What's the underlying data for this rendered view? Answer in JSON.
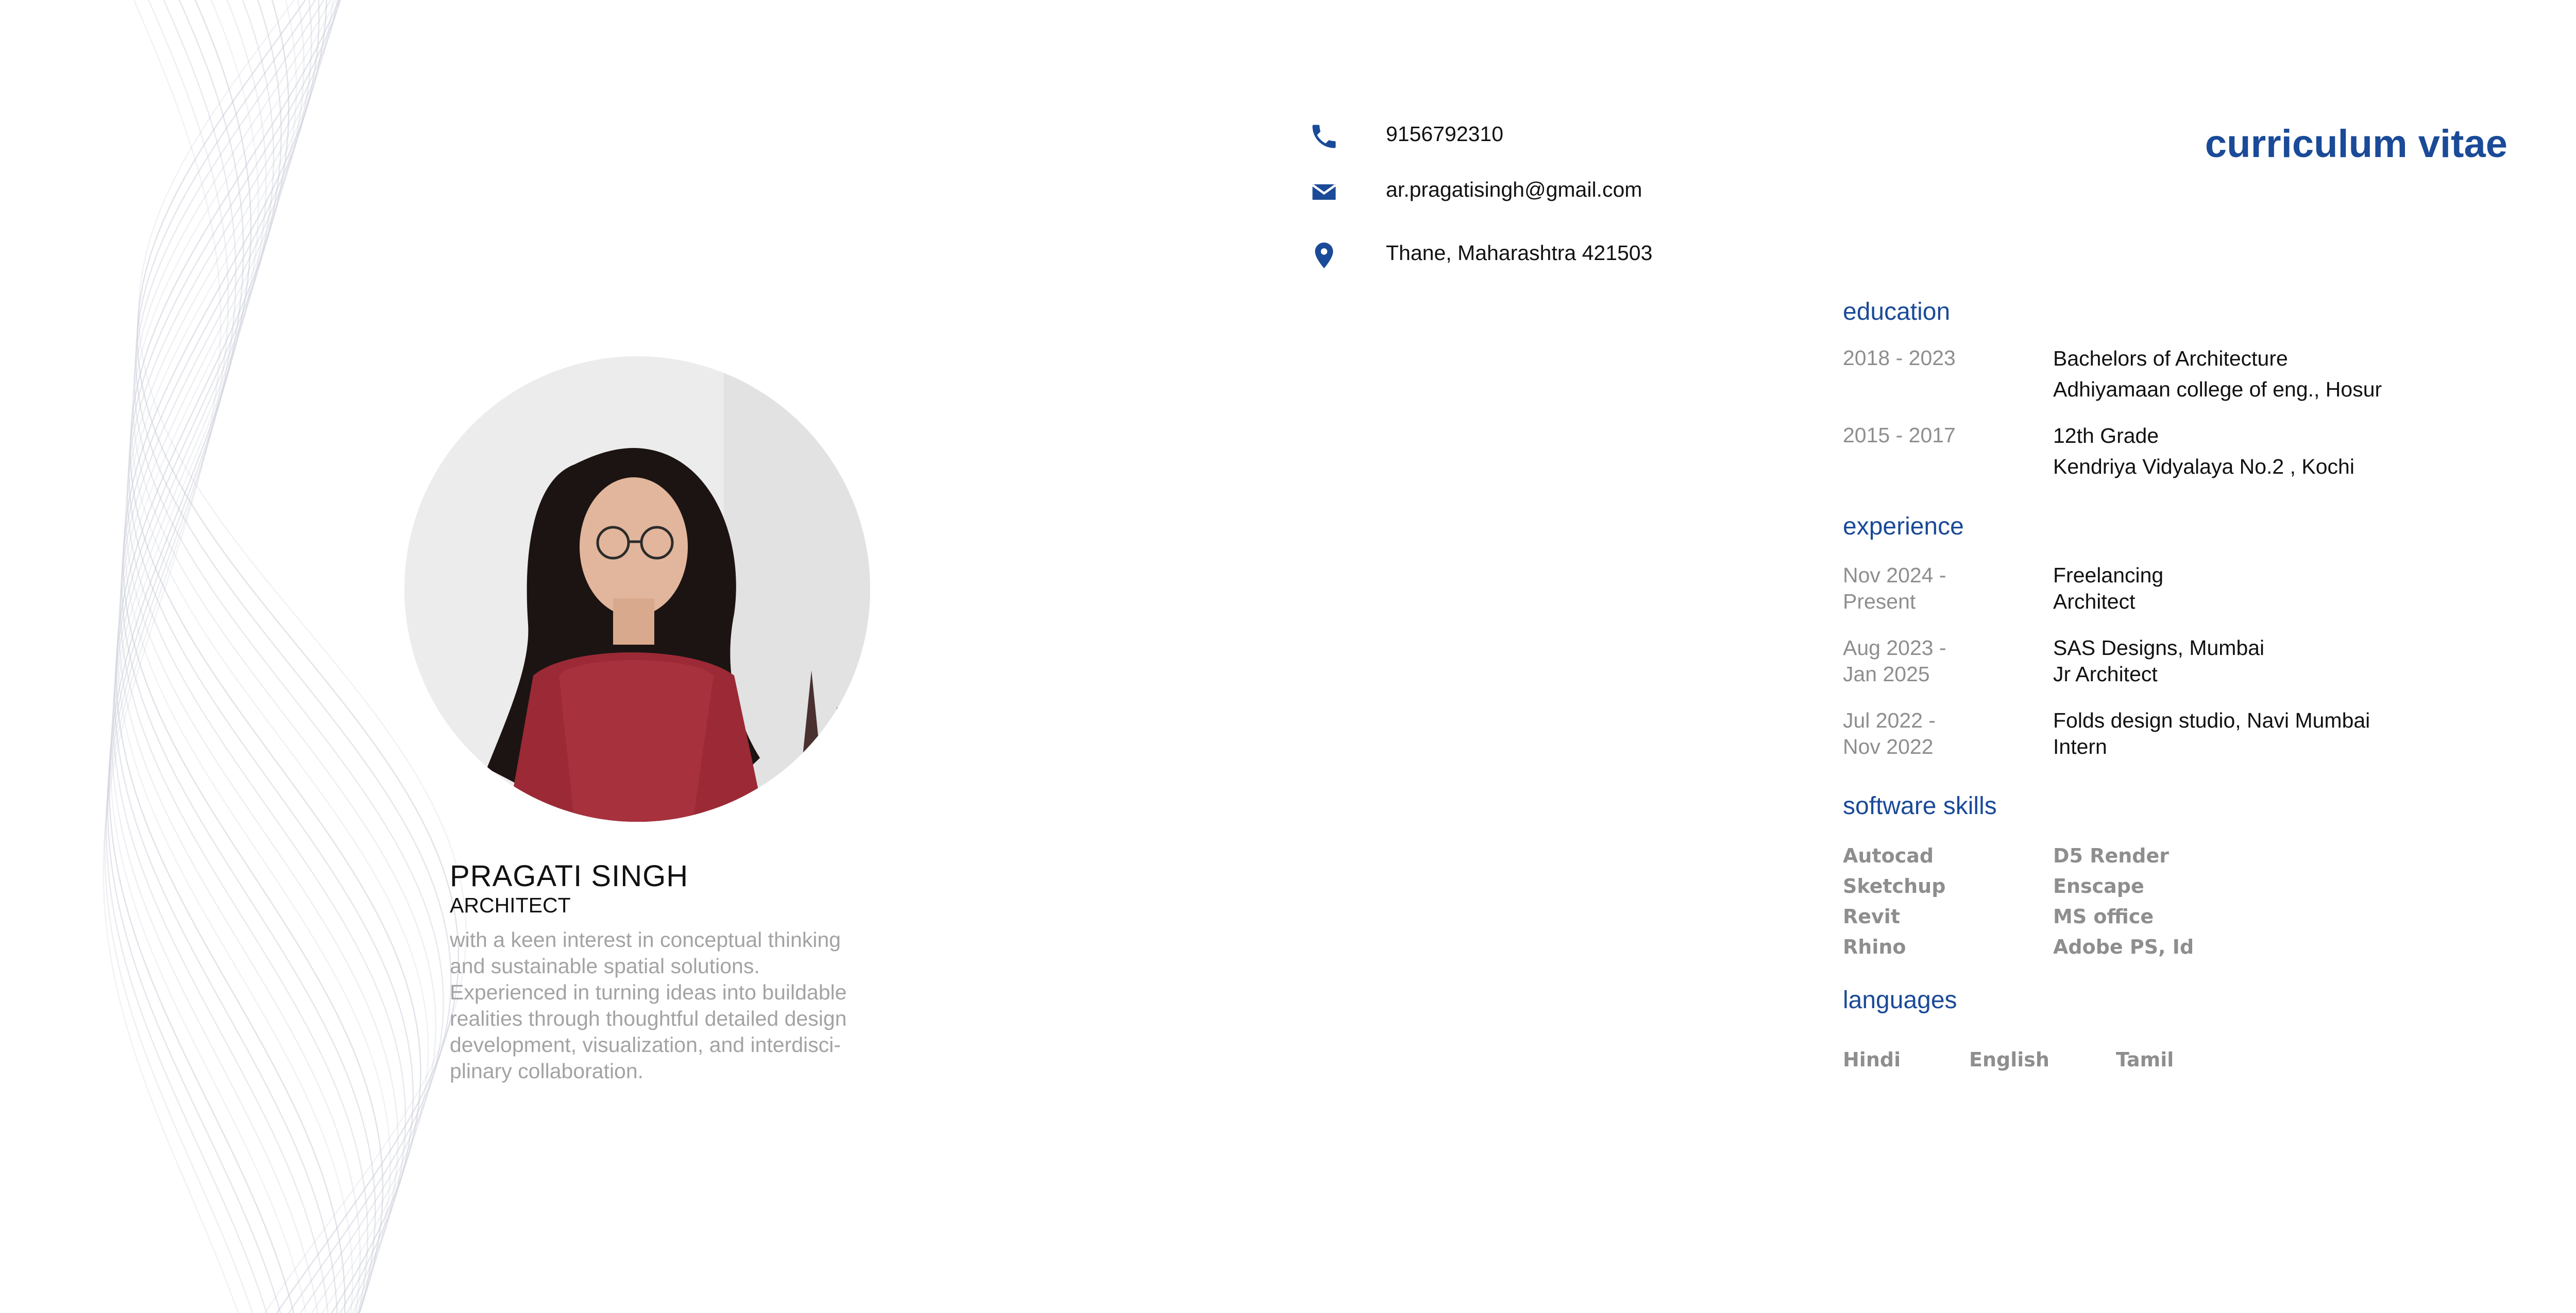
{
  "profile": {
    "name": "PRAGATI SINGH",
    "role": "ARCHITECT",
    "bio": [
      "with a keen interest in conceptual thinking",
      "and sustainable spatial solutions.",
      "Experienced in turning ideas into buildable",
      "realities through thoughtful detailed design",
      "development, visualization, and interdisci-",
      "plinary collaboration."
    ]
  },
  "contact": {
    "phone": "9156792310",
    "email": "ar.pragatisingh@gmail.com",
    "address": "Thane, Maharashtra 421503",
    "icons": [
      "phone-icon",
      "mail-icon",
      "location-pin-icon"
    ]
  },
  "cv_title": "curriculum vitae",
  "education": {
    "heading": "education",
    "items": [
      {
        "years": "2018 - 2023",
        "title": "Bachelors of Architecture",
        "place": "Adhiyamaan college of eng., Hosur"
      },
      {
        "years": "2015 - 2017",
        "title": "12th Grade",
        "place": "Kendriya Vidyalaya No.2 , Kochi"
      }
    ]
  },
  "experience": {
    "heading": "experience",
    "items": [
      {
        "from": "Nov 2024 -",
        "to": "Present",
        "org": "Freelancing",
        "role": "Architect"
      },
      {
        "from": "Aug 2023 -",
        "to": "Jan 2025",
        "org": "SAS Designs, Mumbai",
        "role": "Jr Architect"
      },
      {
        "from": "Jul 2022 -",
        "to": "Nov 2022",
        "org": "Folds design studio, Navi Mumbai",
        "role": "Intern"
      }
    ]
  },
  "software": {
    "heading": "software skills",
    "left": [
      "Autocad",
      "Sketchup",
      "Revit",
      "Rhino"
    ],
    "right": [
      "D5 Render",
      "Enscape",
      "MS office",
      "Adobe PS, Id"
    ]
  },
  "languages": {
    "heading": "languages",
    "items": [
      "Hindi",
      "English",
      "Tamil"
    ]
  },
  "colors": {
    "accent": "#1a4a98",
    "muted": "#8e8e8e",
    "bio": "#a3a3a3",
    "text": "#111111"
  }
}
